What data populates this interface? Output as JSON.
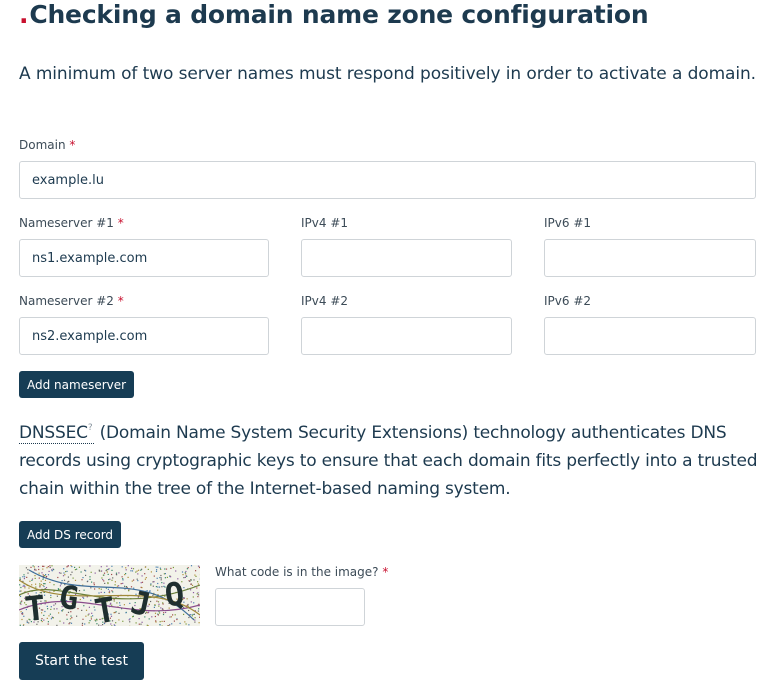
{
  "page": {
    "title_dot": ".",
    "title": "Checking a domain name zone configuration",
    "intro": "A minimum of two server names must respond positively in order to activate a domain."
  },
  "form": {
    "required_mark": "*",
    "domain": {
      "label": "Domain",
      "value": "example.lu"
    },
    "ns1": {
      "label": "Nameserver #1",
      "value": "ns1.example.com"
    },
    "ipv4_1": {
      "label": "IPv4 #1",
      "value": ""
    },
    "ipv6_1": {
      "label": "IPv6 #1",
      "value": ""
    },
    "ns2": {
      "label": "Nameserver #2",
      "value": "ns2.example.com"
    },
    "ipv4_2": {
      "label": "IPv4 #2",
      "value": ""
    },
    "ipv6_2": {
      "label": "IPv6 #2",
      "value": ""
    },
    "add_nameserver_label": "Add nameserver"
  },
  "dnssec": {
    "link": "DNSSEC",
    "help_mark": "?",
    "text": " (Domain Name System Security Extensions) technology authenticates DNS records using cryptographic keys to ensure that each domain fits perfectly into a trusted chain within the tree of the Internet-based naming system.",
    "add_ds_label": "Add DS record"
  },
  "captcha": {
    "image_text": "TGTJQ",
    "label": "What code is in the image?",
    "value": ""
  },
  "submit_label": "Start the test",
  "colors": {
    "primary": "#163d55",
    "text": "#1d3a4f",
    "required": "#c8102e"
  }
}
